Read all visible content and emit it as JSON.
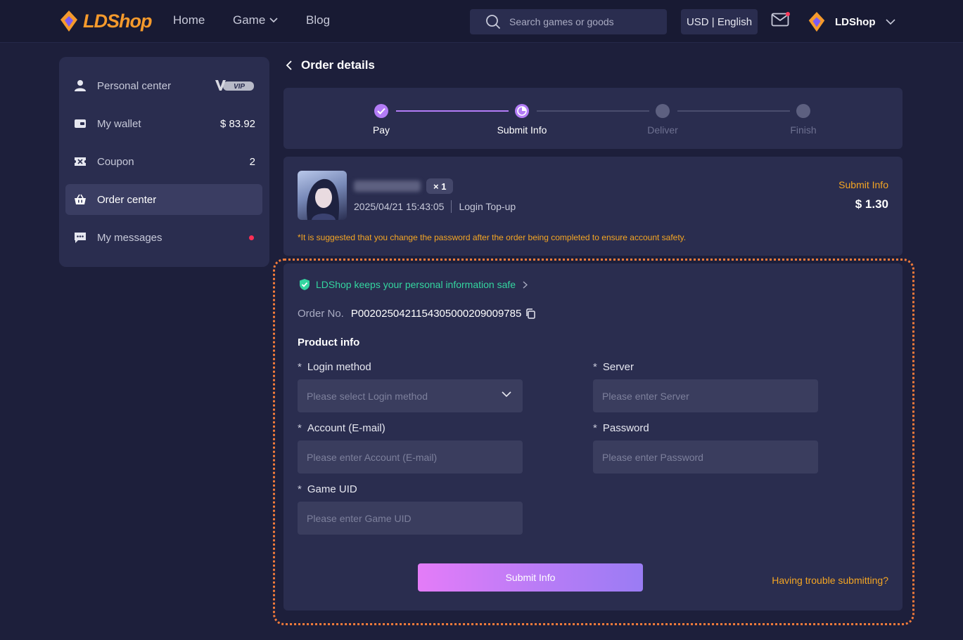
{
  "header": {
    "logo_text": "LDShop",
    "nav": {
      "home": "Home",
      "game": "Game",
      "blog": "Blog"
    },
    "search_placeholder": "Search games or goods",
    "currency_language": "USD | English",
    "username": "LDShop"
  },
  "sidebar": {
    "items": [
      {
        "label": "Personal center",
        "value": "VIP",
        "icon": "person-icon"
      },
      {
        "label": "My wallet",
        "value": "$ 83.92",
        "icon": "wallet-icon"
      },
      {
        "label": "Coupon",
        "value": "2",
        "icon": "coupon-icon"
      },
      {
        "label": "Order center",
        "value": "",
        "icon": "basket-icon"
      },
      {
        "label": "My messages",
        "value": "",
        "icon": "message-icon"
      }
    ],
    "active": "Order center"
  },
  "page": {
    "title": "Order details"
  },
  "steps": [
    {
      "label": "Pay",
      "state": "done"
    },
    {
      "label": "Submit Info",
      "state": "current"
    },
    {
      "label": "Deliver",
      "state": "pending"
    },
    {
      "label": "Finish",
      "state": "pending"
    }
  ],
  "order": {
    "quantity": "× 1",
    "datetime": "2025/04/21 15:43:05",
    "type": "Login Top-up",
    "status": "Submit Info",
    "price": "$ 1.30",
    "warning": "*It is suggested that you change the password after the order being completed to ensure account safety."
  },
  "form": {
    "safe_text": "LDShop keeps your personal information safe",
    "order_no_label": "Order No.",
    "order_no": "P0020250421154305000209009785",
    "product_info_title": "Product info",
    "fields": {
      "login_method": {
        "label": "Login method",
        "placeholder": "Please select Login method"
      },
      "server": {
        "label": "Server",
        "placeholder": "Please enter Server"
      },
      "account": {
        "label": "Account (E-mail)",
        "placeholder": "Please enter Account (E-mail)"
      },
      "password": {
        "label": "Password",
        "placeholder": "Please enter Password"
      },
      "game_uid": {
        "label": "Game UID",
        "placeholder": "Please enter Game UID"
      }
    },
    "submit_label": "Submit Info",
    "trouble_link": "Having trouble submitting?"
  },
  "colors": {
    "accent_purple": "#b37cf7",
    "accent_orange": "#f5a623",
    "safe_green": "#34d6a0",
    "background": "#1d1f3b",
    "card": "#2a2d4f"
  }
}
